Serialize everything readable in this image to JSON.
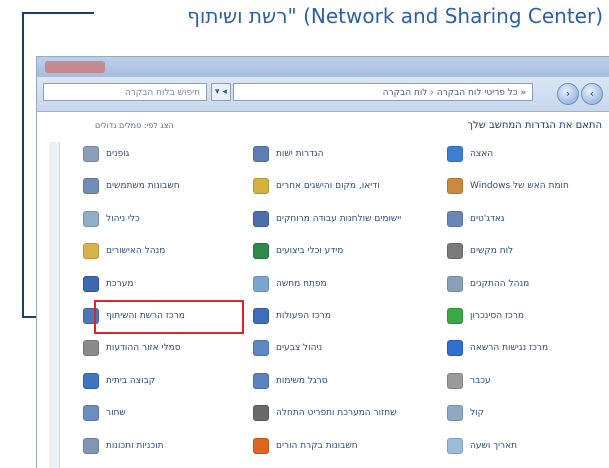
{
  "caption": {
    "text": "רשת ושיתוף\" (Network and Sharing Center)"
  },
  "window": {
    "address": "« כל פריטי לוח הבקרה ‹ לוח הבקרה",
    "search_placeholder": "חיפוש בלוח הבקרה",
    "heading": "התאם את הגדרות המחשב שלך",
    "view_by": "הצג לפי: סמלים גדולים"
  },
  "items": [
    {
      "label": "האצה",
      "color": "#3c7fd1"
    },
    {
      "label": "חומת האש של Windows",
      "color": "#c9893f"
    },
    {
      "label": "גאדג'טים",
      "color": "#6a86b8"
    },
    {
      "label": "לוח מקשים",
      "color": "#7a7a7a"
    },
    {
      "label": "מנהל ההתקנים",
      "color": "#8aa0b8"
    },
    {
      "label": "מרכז הסינכרון",
      "color": "#3aa845"
    },
    {
      "label": "מרכז נגישות הרשאה",
      "color": "#2f6fcf"
    },
    {
      "label": "עכבר",
      "color": "#9a9a9a"
    },
    {
      "label": "קול",
      "color": "#8fa8c4"
    },
    {
      "label": "תאריך ושעה",
      "color": "#9bbbd8"
    },
    {
      "label": "הגדרות ישות",
      "color": "#5b7fb0"
    },
    {
      "label": "ודיאו, מקום והישגים אחרים",
      "color": "#d4b23c"
    },
    {
      "label": "יישומים שולחנות עבודה מרוחקים",
      "color": "#4b6fa8"
    },
    {
      "label": "מידע וכלי ביצועים",
      "color": "#2f8a4a"
    },
    {
      "label": "מפתח מחשה",
      "color": "#7aa7d0"
    },
    {
      "label": "מרכז הפעולות",
      "color": "#3d6fb8"
    },
    {
      "label": "ניהול צבעים",
      "color": "#5c8ac0"
    },
    {
      "label": "סרגל משימות",
      "color": "#5b84c0"
    },
    {
      "label": "שחזור המערכת ותפריט התחלה",
      "color": "#6a6a6a"
    },
    {
      "label": "חשבונות בקרת הורים",
      "color": "#e0661f"
    },
    {
      "label": "גופנים",
      "color": "#8aa0b8"
    },
    {
      "label": "חשבונות משתמשים",
      "color": "#6f8fb8"
    },
    {
      "label": "כלי ניהול",
      "color": "#8fb0c8"
    },
    {
      "label": "מנהל האישורים",
      "color": "#d8b24a"
    },
    {
      "label": "מערכת",
      "color": "#3d68b0"
    },
    {
      "label": "מרכז הרשת והשיתוף",
      "color": "#4a78b8"
    },
    {
      "label": "סמלי אזור ההודעות",
      "color": "#8a8a8a"
    },
    {
      "label": "קבוצה ביתית",
      "color": "#3f74c0"
    },
    {
      "label": "שחור",
      "color": "#6a8fc0"
    },
    {
      "label": "תוכניות ותכונות",
      "color": "#7f96b4"
    }
  ]
}
